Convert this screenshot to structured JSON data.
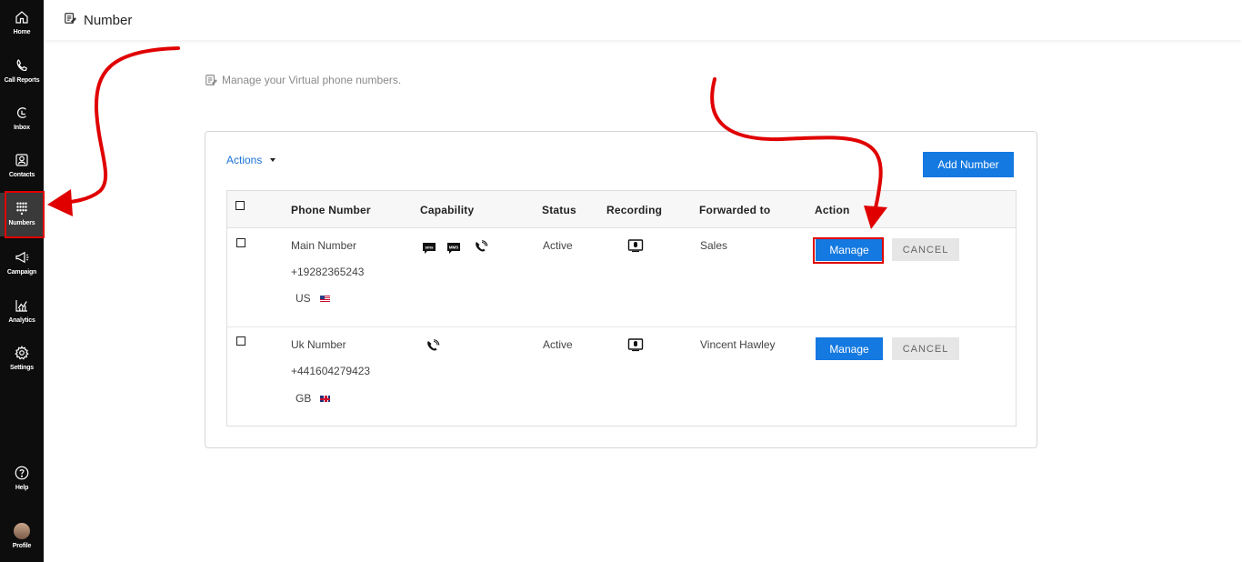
{
  "sidebar": {
    "items": [
      {
        "label": "Home",
        "icon": "home-icon"
      },
      {
        "label": "Call Reports",
        "icon": "phone-icon"
      },
      {
        "label": "Inbox",
        "icon": "inbox-icon"
      },
      {
        "label": "Contacts",
        "icon": "contacts-icon"
      },
      {
        "label": "Numbers",
        "icon": "keypad-icon",
        "active": true
      },
      {
        "label": "Campaign",
        "icon": "megaphone-icon"
      },
      {
        "label": "Analytics",
        "icon": "analytics-icon"
      },
      {
        "label": "Settings",
        "icon": "gear-icon"
      }
    ],
    "help_label": "Help",
    "profile_label": "Profile"
  },
  "header": {
    "title": "Number",
    "icon": "document-icon"
  },
  "subtitle": "Manage your Virtual phone numbers.",
  "card": {
    "actions_label": "Actions",
    "add_button_label": "Add Number"
  },
  "table": {
    "columns": [
      "Phone Number",
      "Capability",
      "Status",
      "Recording",
      "Forwarded to",
      "Action"
    ],
    "rows": [
      {
        "name": "Main Number",
        "number": "+19282365243",
        "country": "US",
        "capabilities": [
          "sms-icon",
          "mms-icon",
          "voice-call-icon"
        ],
        "status": "Active",
        "recording_icon": "recording-icon",
        "forwarded_to": "Sales",
        "manage_label": "Manage",
        "cancel_label": "CANCEL"
      },
      {
        "name": "Uk Number",
        "number": "+441604279423",
        "country": "GB",
        "capabilities": [
          "voice-call-icon"
        ],
        "status": "Active",
        "recording_icon": "recording-icon",
        "forwarded_to": "Vincent Hawley",
        "manage_label": "Manage",
        "cancel_label": "CANCEL"
      }
    ]
  },
  "colors": {
    "accent": "#1479e0",
    "sidebar_bg": "#0d0d0d",
    "annotation_red": "#e00000"
  }
}
